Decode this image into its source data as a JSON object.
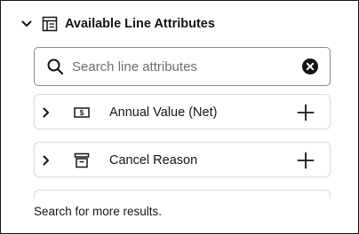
{
  "panel": {
    "title": "Available Line Attributes",
    "collapse_icon": "chevron-down-icon",
    "header_icon": "attributes-panel-icon"
  },
  "search": {
    "placeholder": "Search line attributes",
    "value": "",
    "icon": "search-icon",
    "clear_icon": "clear-circle-icon"
  },
  "attributes": [
    {
      "label": "Annual Value (Net)",
      "icon": "currency-note-icon",
      "expand_icon": "chevron-right-icon",
      "add_icon": "plus-icon"
    },
    {
      "label": "Cancel Reason",
      "icon": "archive-box-icon",
      "expand_icon": "chevron-right-icon",
      "add_icon": "plus-icon"
    }
  ],
  "footer": {
    "message": "Search for more results."
  },
  "colors": {
    "text": "#161513",
    "border": "#8b8a87",
    "card_border": "#dedbd8",
    "placeholder": "#6f6e6b"
  }
}
